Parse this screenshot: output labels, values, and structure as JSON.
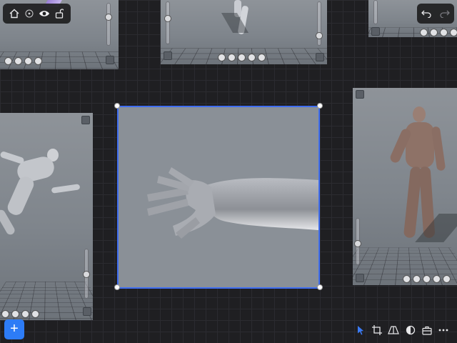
{
  "toolbar_top_left": {
    "items": [
      {
        "name": "home-icon"
      },
      {
        "name": "info-icon"
      },
      {
        "name": "eye-icon"
      },
      {
        "name": "unlock-icon"
      }
    ]
  },
  "toolbar_top_right": {
    "items": [
      {
        "name": "undo-icon"
      },
      {
        "name": "redo-icon"
      }
    ]
  },
  "add_button": {
    "label": "+"
  },
  "toolbar_bottom_right": {
    "items": [
      {
        "name": "pointer-icon",
        "active": true
      },
      {
        "name": "crop-icon"
      },
      {
        "name": "perspective-icon"
      },
      {
        "name": "contrast-icon"
      },
      {
        "name": "toolbox-icon"
      },
      {
        "name": "more-icon"
      }
    ]
  },
  "colors": {
    "background": "#1f1f22",
    "grid": "#2b2b30",
    "selection": "#3f6df0",
    "accent": "#2d7cf6",
    "panel": "#8a9097"
  },
  "canvas": {
    "selected_card": "arm-hand-reference",
    "cards": [
      "pose-card-top-left",
      "pose-card-top-center",
      "pose-card-top-right",
      "pose-card-left-runner",
      "arm-hand-reference",
      "pose-card-right-standing"
    ]
  }
}
